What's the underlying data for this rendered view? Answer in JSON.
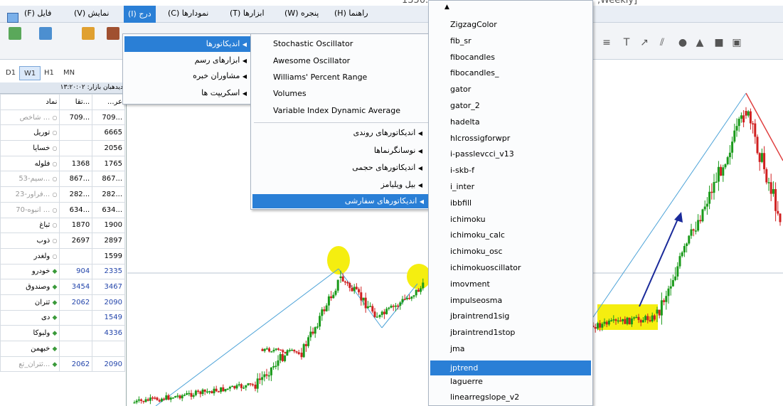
{
  "titlebar": {
    "left_text": "1350.",
    "right_text": ",Weekly]"
  },
  "menu": {
    "file": "فایل (F)",
    "view": "نمایش (V)",
    "insert": "درج (I)",
    "charts": "نمودارها (C)",
    "tools": "ابزارها (T)",
    "window": "پنجره (W)",
    "help": "راهنما (H)"
  },
  "periods": [
    "D1",
    "W1",
    "H1",
    "MN"
  ],
  "watchlist": {
    "header": "دیدهبان بازار: ۱۳:۲۰:۰۲",
    "columns": [
      "نماد",
      "تقا...",
      "...عر"
    ],
    "rows": [
      {
        "name": "... شاخص",
        "bid": "709...",
        "ask": "709...",
        "icon": "circle"
      },
      {
        "name": "توریل",
        "bid": "",
        "ask": "6665",
        "icon": "circle"
      },
      {
        "name": "خسایا",
        "bid": "",
        "ask": "2056",
        "icon": "circle"
      },
      {
        "name": "فلوله",
        "bid": "1368",
        "ask": "1765",
        "icon": "circle"
      },
      {
        "name": "...سیم-53",
        "bid": "867...",
        "ask": "867...",
        "icon": "circle"
      },
      {
        "name": "...فراور-23",
        "bid": "282...",
        "ask": "282...",
        "icon": "circle"
      },
      {
        "name": "... انبوه-70",
        "bid": "634...",
        "ask": "634...",
        "icon": "circle"
      },
      {
        "name": "ثباغ",
        "bid": "1870",
        "ask": "1900",
        "icon": "circle"
      },
      {
        "name": "ذوب",
        "bid": "2697",
        "ask": "2897",
        "icon": "circle"
      },
      {
        "name": "ولغدر",
        "bid": "",
        "ask": "1599",
        "icon": "circle"
      },
      {
        "name": "خودرو",
        "bid": "904",
        "ask": "2335",
        "icon": "diamond"
      },
      {
        "name": "وصندوق",
        "bid": "3454",
        "ask": "3467",
        "icon": "diamond"
      },
      {
        "name": "ثتران",
        "bid": "2062",
        "ask": "2090",
        "icon": "diamond"
      },
      {
        "name": "دی",
        "bid": "",
        "ask": "1549",
        "icon": "diamond"
      },
      {
        "name": "ولبوکا",
        "bid": "",
        "ask": "4336",
        "icon": "diamond"
      },
      {
        "name": "خبهمن",
        "bid": "",
        "ask": "",
        "icon": "diamond"
      },
      {
        "name": "...ثتران_تع",
        "bid": "2062",
        "ask": "2090",
        "icon": "diamond"
      }
    ]
  },
  "insert_menu": [
    "اندیکاتورها",
    "ابزارهای رسم",
    "مشاوران خبره",
    "اسکریپت ها"
  ],
  "indicators_menu": {
    "items": [
      "Stochastic Oscillator",
      "Awesome Oscillator",
      "Williams' Percent Range",
      "Volumes",
      "Variable Index Dynamic Average"
    ],
    "groups": [
      "اندیکاتورهای روندی",
      "نوسانگرنماها",
      "اندیکاتورهای حجمی",
      "بیل ویلیامز",
      "اندیکاتورهای سفارشی"
    ]
  },
  "custom_menu": {
    "items": [
      "ZigzagColor",
      "fib_sr",
      "fibocandles",
      "fibocandles_",
      "gator",
      "gator_2",
      "hadelta",
      "hlcrossigforwpr",
      "i-passlevcci_v13",
      "i-skb-f",
      "i_inter",
      "ibbfill",
      "ichimoku",
      "ichimoku_calc",
      "ichimoku_osc",
      "ichimokuoscillator",
      "imovment",
      "impulseosma",
      "jbraintrend1sig",
      "jbraintrend1stop",
      "jma",
      "jptrend",
      "laguerre",
      "linearregslope_v2"
    ],
    "selected": "jptrend"
  },
  "colors": {
    "accent": "#2a7fd6",
    "bull": "#1a9a1a",
    "bear": "#d02020",
    "highlight": "#f5ee10"
  }
}
